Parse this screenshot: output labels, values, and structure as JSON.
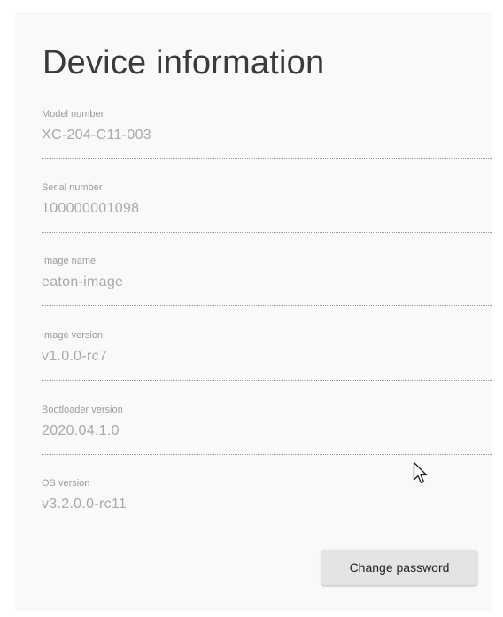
{
  "page": {
    "title": "Device information"
  },
  "fields": [
    {
      "label": "Model number",
      "value": "XC-204-C11-003"
    },
    {
      "label": "Serial number",
      "value": "100000001098"
    },
    {
      "label": "Image name",
      "value": "eaton-image"
    },
    {
      "label": "Image version",
      "value": "v1.0.0-rc7"
    },
    {
      "label": "Bootloader version",
      "value": "2020.04.1.0"
    },
    {
      "label": "OS version",
      "value": "v3.2.0.0-rc11"
    }
  ],
  "actions": {
    "change_password_label": "Change password"
  },
  "icons": {
    "cursor": "mouse-pointer-icon"
  },
  "colors": {
    "panel_background": "#f9f9f9",
    "button_background": "#e4e4e4",
    "text_primary": "#3a3a3a",
    "text_muted": "#a9a9a9"
  }
}
